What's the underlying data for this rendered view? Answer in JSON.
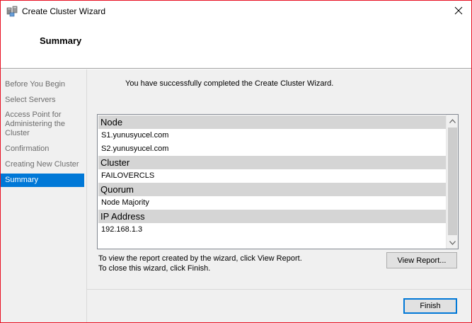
{
  "window": {
    "title": "Create Cluster Wizard",
    "accent_border": "#e81123"
  },
  "header": {
    "title": "Summary"
  },
  "sidebar": {
    "items": [
      {
        "label": "Before You Begin",
        "active": false
      },
      {
        "label": "Select Servers",
        "active": false
      },
      {
        "label": "Access Point for Administering the Cluster",
        "active": false
      },
      {
        "label": "Confirmation",
        "active": false
      },
      {
        "label": "Creating New Cluster",
        "active": false
      },
      {
        "label": "Summary",
        "active": true
      }
    ],
    "active_color": "#0078d7"
  },
  "main": {
    "success_message": "You have successfully completed the Create Cluster Wizard.",
    "report": {
      "sections": [
        {
          "heading": "Node",
          "items": [
            "S1.yunusyucel.com",
            "S2.yunusyucel.com"
          ]
        },
        {
          "heading": "Cluster",
          "items": [
            "FAILOVERCLS"
          ]
        },
        {
          "heading": "Quorum",
          "items": [
            "Node Majority"
          ]
        },
        {
          "heading": "IP Address",
          "items": [
            "192.168.1.3"
          ]
        }
      ]
    },
    "hint_line1": "To view the report created by the wizard, click View Report.",
    "hint_line2": "To close this wizard, click Finish.",
    "view_report_label": "View Report..."
  },
  "footer": {
    "finish_label": "Finish"
  }
}
